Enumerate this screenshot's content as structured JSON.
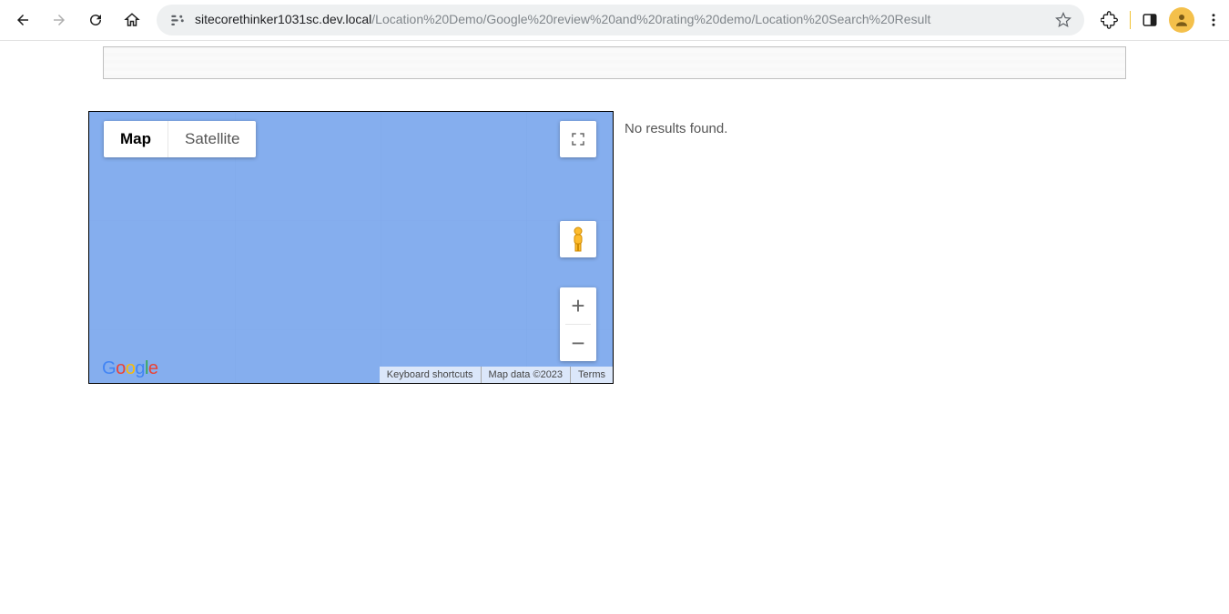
{
  "browser": {
    "url_domain": "sitecorethinker1031sc.dev.local",
    "url_path": "/Location%20Demo/Google%20review%20and%20rating%20demo/Location%20Search%20Result"
  },
  "map": {
    "type_buttons": {
      "map": "Map",
      "satellite": "Satellite"
    },
    "footer": {
      "shortcuts": "Keyboard shortcuts",
      "data": "Map data ©2023",
      "terms": "Terms"
    }
  },
  "results": {
    "empty_message": "No results found."
  }
}
